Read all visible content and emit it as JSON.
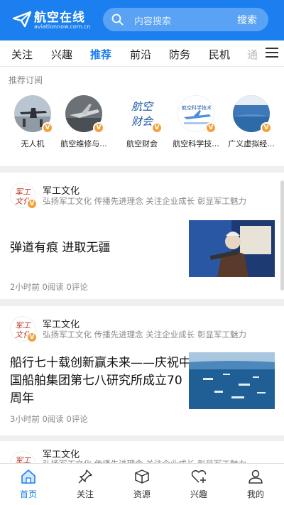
{
  "header": {
    "logo_title": "航空在线",
    "logo_url": "aviationnow.com.cn",
    "search_placeholder": "内容搜索",
    "search_button": "搜索"
  },
  "tabs": [
    {
      "label": "关注"
    },
    {
      "label": "兴趣"
    },
    {
      "label": "推荐"
    },
    {
      "label": "前沿"
    },
    {
      "label": "防务"
    },
    {
      "label": "民机"
    },
    {
      "label": "通"
    }
  ],
  "subscriptions": {
    "title": "推荐订阅",
    "items": [
      {
        "label": "无人机"
      },
      {
        "label": "航空维修与..."
      },
      {
        "label": "航空财会"
      },
      {
        "label": "航空科学技..."
      },
      {
        "label": "广义虚拟经..."
      }
    ]
  },
  "feed": [
    {
      "author": "军工文化",
      "author_desc": "弘扬军工文化 传播先进理念 关注企业成长 彰显军工魅力",
      "title_lines": [
        "弹道有痕 进取无疆"
      ],
      "meta": "2小时前 0阅读 0评论"
    },
    {
      "author": "军工文化",
      "author_desc": "弘扬军工文化 传播先进理念 关注企业成长 彰显军工魅力",
      "title_lines": [
        "船行七十载创新赢未来——庆祝中",
        "国船舶集团第七八研究所成立70",
        "周年"
      ],
      "meta": "3小时前 0阅读 0评论"
    },
    {
      "author": "军工文化",
      "author_desc": "弘扬军工文化 传播先进理念 关注企业成长 彰显军工魅力"
    }
  ],
  "bottom_nav": [
    {
      "label": "首页",
      "icon": "home-icon"
    },
    {
      "label": "关注",
      "icon": "pin-icon"
    },
    {
      "label": "资源",
      "icon": "box-icon"
    },
    {
      "label": "兴趣",
      "icon": "heart-plus-icon"
    },
    {
      "label": "我的",
      "icon": "user-icon"
    }
  ],
  "colors": {
    "accent": "#1c7ff0",
    "badge": "#f2a23b"
  },
  "avatar_text": {
    "navy_logo": "航空财会",
    "science_logo": "航空科学技术",
    "culture_logo": "军工文化"
  }
}
